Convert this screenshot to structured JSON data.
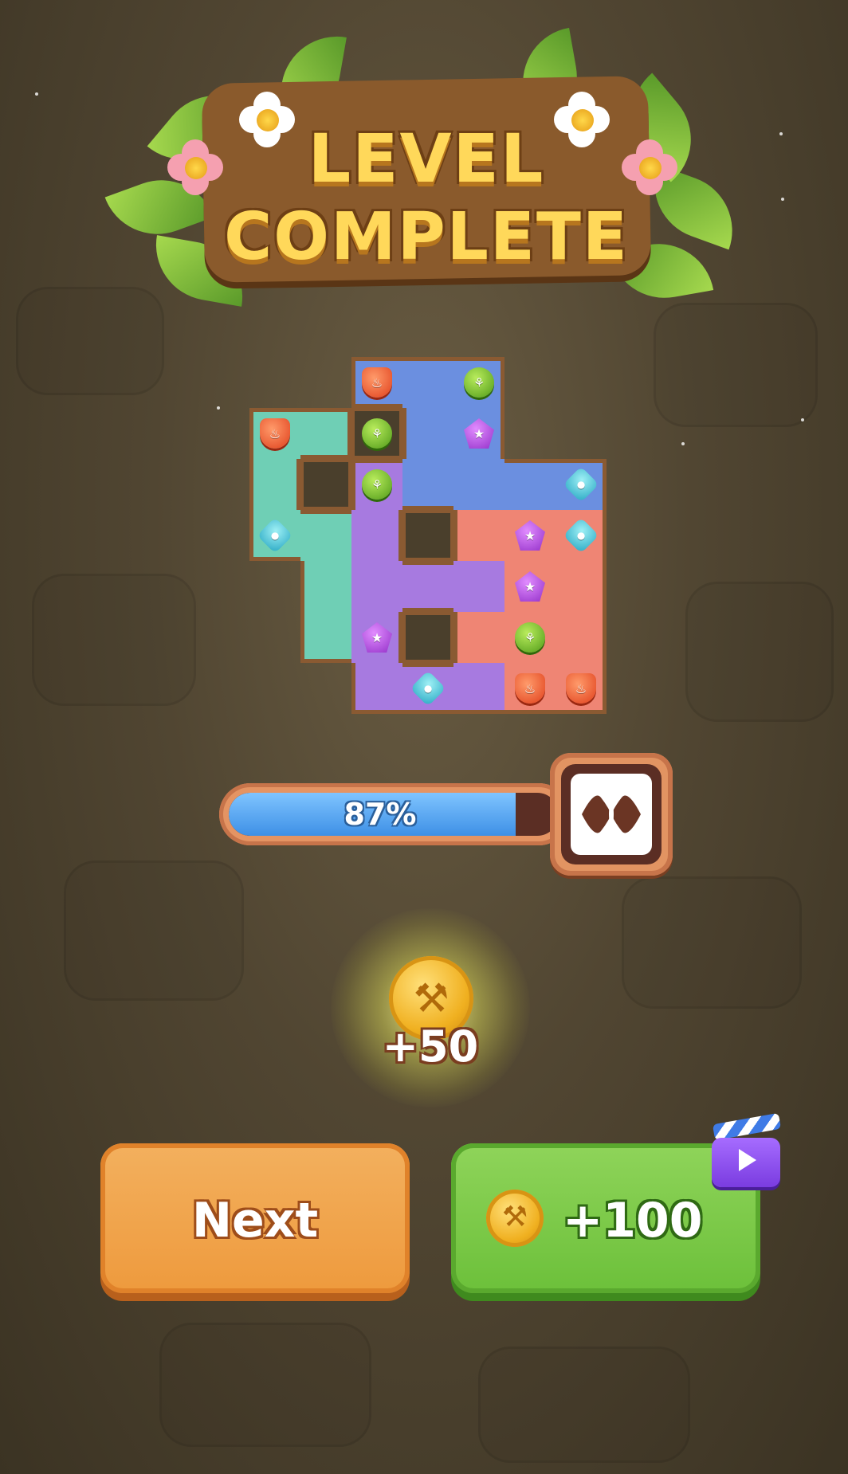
{
  "title": {
    "line1": "LEVEL",
    "line2": "COMPLETE"
  },
  "progress": {
    "percent_label": "87%",
    "value": 0.87
  },
  "reward": {
    "amount": "+50",
    "coin_icon": "shovel-coin-icon"
  },
  "buttons": {
    "next_label": "Next",
    "bonus_label": "+100",
    "bonus_icon": "video-ad-icon"
  },
  "colors": {
    "board_blue": "#6b8fe0",
    "board_teal": "#6fcfb5",
    "board_purple": "#a77ae0",
    "board_coral": "#ef8574",
    "frame_brown": "#8a5a32",
    "progress_fill": "#4ea0ee",
    "next_orange": "#f0a44a",
    "bonus_green": "#76c746"
  },
  "board": {
    "cols": 7,
    "rows": 7,
    "cells": [
      "..BBB..",
      "TTHBB..",
      "THPBBBB",
      "TTPHCCC",
      ".TPPPCC",
      ".TPHCCC",
      "..PPPCC"
    ],
    "gems": [
      {
        "row": 0,
        "col": 2,
        "type": "fire"
      },
      {
        "row": 0,
        "col": 4,
        "type": "leaf"
      },
      {
        "row": 1,
        "col": 0,
        "type": "fire"
      },
      {
        "row": 1,
        "col": 2,
        "type": "leaf"
      },
      {
        "row": 1,
        "col": 4,
        "type": "star"
      },
      {
        "row": 2,
        "col": 2,
        "type": "leaf"
      },
      {
        "row": 2,
        "col": 6,
        "type": "drop"
      },
      {
        "row": 3,
        "col": 0,
        "type": "drop"
      },
      {
        "row": 3,
        "col": 5,
        "type": "star"
      },
      {
        "row": 3,
        "col": 6,
        "type": "drop"
      },
      {
        "row": 4,
        "col": 5,
        "type": "star"
      },
      {
        "row": 5,
        "col": 2,
        "type": "star"
      },
      {
        "row": 5,
        "col": 5,
        "type": "leaf"
      },
      {
        "row": 6,
        "col": 3,
        "type": "drop"
      },
      {
        "row": 6,
        "col": 5,
        "type": "fire"
      },
      {
        "row": 6,
        "col": 6,
        "type": "fire"
      }
    ]
  }
}
